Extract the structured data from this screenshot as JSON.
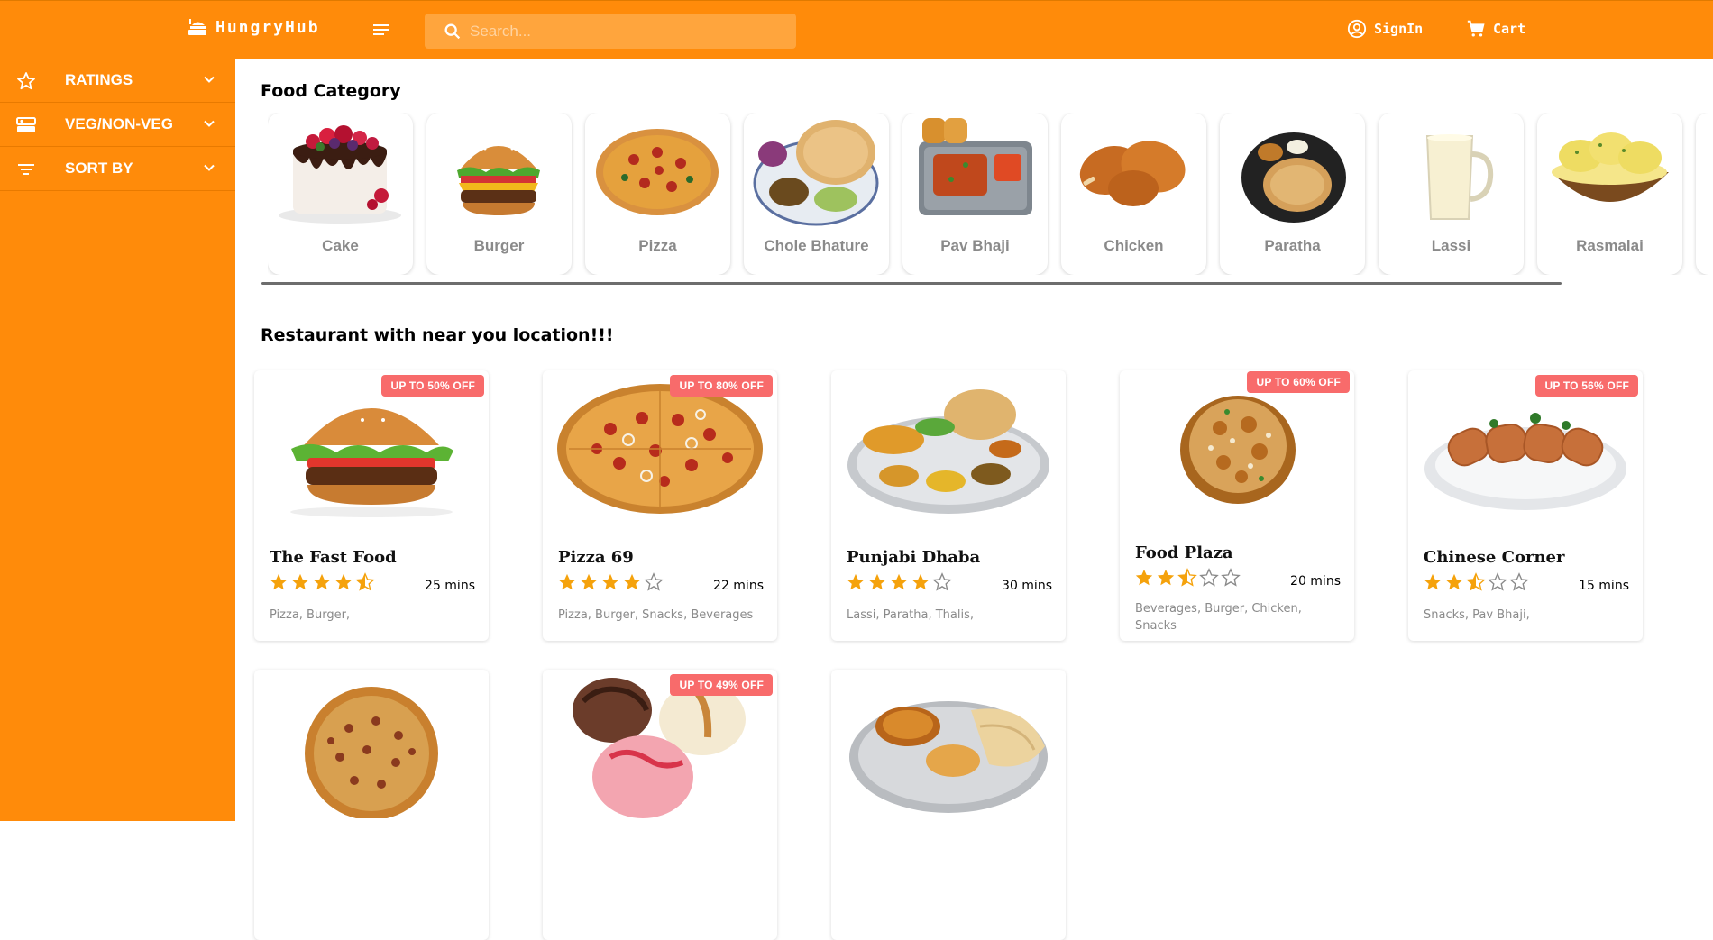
{
  "header": {
    "brand": "HungryHub",
    "search_placeholder": "Search...",
    "signin_label": "SignIn",
    "cart_label": "Cart",
    "colors": {
      "header_bg": "#ff8b0a",
      "search_bg": "#ffa53d"
    }
  },
  "sidebar": {
    "filters": [
      {
        "label": "RATINGS",
        "icon": "star-outline-icon"
      },
      {
        "label": "VEG/NON-VEG",
        "icon": "veg-nonveg-icon"
      },
      {
        "label": "SORT BY",
        "icon": "sort-icon"
      }
    ]
  },
  "main": {
    "category_title": "Food Category",
    "categories": [
      {
        "label": "Cake",
        "image": "cake-image"
      },
      {
        "label": "Burger",
        "image": "burger-image"
      },
      {
        "label": "Pizza",
        "image": "pizza-image"
      },
      {
        "label": "Chole Bhature",
        "image": "chole-bhature-image"
      },
      {
        "label": "Pav Bhaji",
        "image": "pav-bhaji-image"
      },
      {
        "label": "Chicken",
        "image": "chicken-image"
      },
      {
        "label": "Paratha",
        "image": "paratha-image"
      },
      {
        "label": "Lassi",
        "image": "lassi-image"
      },
      {
        "label": "Rasmalai",
        "image": "rasmalai-image"
      }
    ],
    "restaurants_title": "Restaurant with near you location!!!",
    "restaurants": [
      {
        "name": "The Fast Food",
        "discount": "UP TO 50% OFF",
        "rating": 4.5,
        "time": "25 mins",
        "tags": "Pizza, Burger,",
        "image": "burger-image"
      },
      {
        "name": "Pizza 69",
        "discount": "UP TO 80% OFF",
        "rating": 4,
        "time": "22 mins",
        "tags": "Pizza, Burger, Snacks, Beverages",
        "image": "pizza-image"
      },
      {
        "name": "Punjabi Dhaba",
        "discount": "",
        "rating": 4,
        "time": "30 mins",
        "tags": "Lassi, Paratha, Thalis,",
        "image": "thali-image"
      },
      {
        "name": "Food Plaza",
        "discount": "UP TO 60% OFF",
        "rating": 2.5,
        "time": "20 mins",
        "tags": "Beverages, Burger, Chicken, Snacks",
        "image": "biryani-image"
      },
      {
        "name": "Chinese Corner",
        "discount": "UP TO 56% OFF",
        "rating": 2.5,
        "time": "15 mins",
        "tags": "Snacks, Pav Bhaji,",
        "image": "spring-rolls-image"
      },
      {
        "name": "",
        "discount": "",
        "rating": null,
        "time": "",
        "tags": "",
        "image": "pizza-image"
      },
      {
        "name": "",
        "discount": "UP TO 49% OFF",
        "rating": null,
        "time": "",
        "tags": "",
        "image": "ice-cream-image"
      },
      {
        "name": "",
        "discount": "",
        "rating": null,
        "time": "",
        "tags": "",
        "image": "thali-image"
      }
    ]
  }
}
